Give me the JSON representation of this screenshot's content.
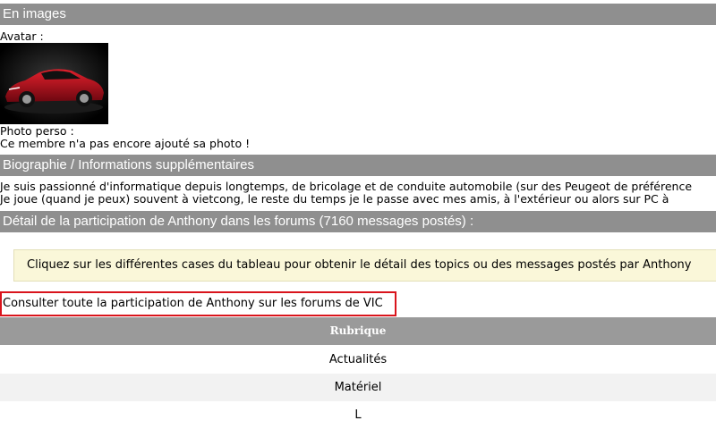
{
  "images_section": {
    "header": "En images",
    "avatar_label": "Avatar :",
    "photo_label": "Photo perso :",
    "photo_text": "Ce membre n'a pas encore ajouté sa photo !"
  },
  "bio_section": {
    "header": "Biographie / Informations supplémentaires",
    "line1": "Je suis passionné d'informatique depuis longtemps, de bricolage et de conduite automobile (sur des Peugeot de préférence",
    "line2": "Je joue (quand je peux) souvent à vietcong, le reste du temps je le passe avec mes amis, à l'extérieur ou alors sur PC à"
  },
  "participation_section": {
    "header": "Détail de la participation de Anthony dans les forums (7160 messages postés) :",
    "notice": "Cliquez sur les différentes cases du tableau pour obtenir le détail des topics ou des messages postés par Anthony",
    "consult_link": "Consulter toute la participation de Anthony sur les forums de VIC"
  },
  "table": {
    "header": "Rubrique",
    "rows": [
      "Actualités",
      "Matériel",
      "L"
    ]
  }
}
